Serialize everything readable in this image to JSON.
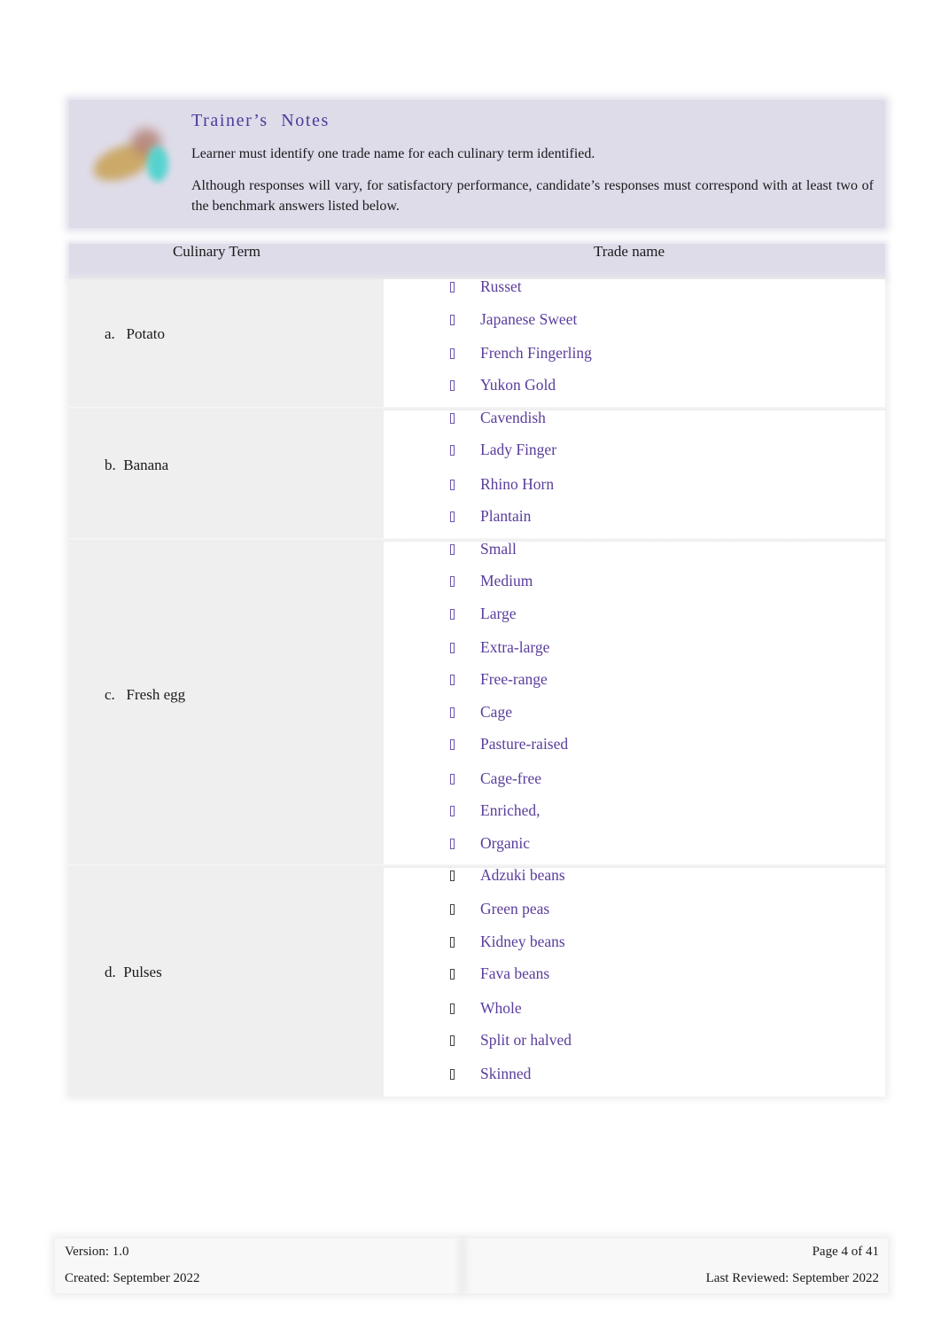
{
  "trainer_notes": {
    "title": "Trainer’s  Notes",
    "icon": "notes-illustration-icon",
    "line1": "Learner must identify one trade name for each culinary term identified.",
    "line2": "Although responses will vary, for satisfactory performance, candidate’s responses must correspond with at least two of the benchmark answers listed below."
  },
  "table": {
    "headers": [
      "Culinary Term",
      "Trade name"
    ],
    "bullet_icon": "missing-glyph-bullet-icon",
    "rows": [
      {
        "term": "a.   Potato",
        "items": [
          "Russet",
          "Japanese Sweet",
          "French Fingerling",
          "Yukon Gold"
        ]
      },
      {
        "term": "b.  Banana",
        "items": [
          "Cavendish",
          "Lady Finger",
          "Rhino Horn",
          "Plantain"
        ]
      },
      {
        "term": "c.   Fresh egg",
        "items": [
          "Small",
          "Medium",
          "Large",
          "Extra-large",
          "Free-range",
          "Cage",
          "Pasture-raised",
          "Cage-free",
          "Enriched,",
          "Organic"
        ]
      },
      {
        "term": "d.  Pulses",
        "items": [
          "Adzuki beans",
          "Green peas",
          "Kidney beans",
          "Fava beans",
          "Whole",
          "Split or halved",
          "Skinned"
        ]
      }
    ]
  },
  "footer": {
    "version": "Version: 1.0",
    "created": "Created: September 2022",
    "page": "Page 4 of 41",
    "last_reviewed": "Last Reviewed: September 2022"
  },
  "colors": {
    "accent_purple": "#5a3d9c",
    "title_purple": "#4b3a9a",
    "header_bg": "#dfdcea",
    "term_cell_bg": "#efefef"
  }
}
